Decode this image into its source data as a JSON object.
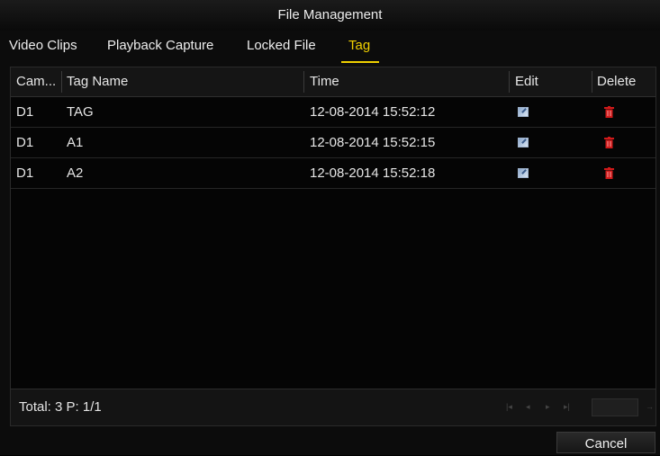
{
  "window": {
    "title": "File Management"
  },
  "tabs": [
    {
      "label": "Video Clips",
      "active": false
    },
    {
      "label": "Playback Capture",
      "active": false
    },
    {
      "label": "Locked File",
      "active": false
    },
    {
      "label": "Tag",
      "active": true
    }
  ],
  "table": {
    "columns": [
      "Cam...",
      "Tag Name",
      "Time",
      "Edit",
      "Delete"
    ],
    "rows": [
      {
        "camera": "D1",
        "tag_name": "TAG",
        "time": "12-08-2014 15:52:12",
        "edit_icon": "edit-icon",
        "delete_icon": "trash-icon"
      },
      {
        "camera": "D1",
        "tag_name": "A1",
        "time": "12-08-2014 15:52:15",
        "edit_icon": "edit-icon",
        "delete_icon": "trash-icon"
      },
      {
        "camera": "D1",
        "tag_name": "A2",
        "time": "12-08-2014 15:52:18",
        "edit_icon": "edit-icon",
        "delete_icon": "trash-icon"
      }
    ]
  },
  "footer": {
    "total_text": "Total: 3 P: 1/1",
    "pager": {
      "first_icon": "first-page-icon",
      "prev_icon": "prev-page-icon",
      "next_icon": "next-page-icon",
      "last_icon": "last-page-icon",
      "go_icon": "go-icon",
      "page_input_value": ""
    }
  },
  "buttons": {
    "cancel_label": "Cancel"
  },
  "colors": {
    "accent": "#f0d000",
    "delete": "#d11a1a",
    "background": "#0c0c0c"
  }
}
